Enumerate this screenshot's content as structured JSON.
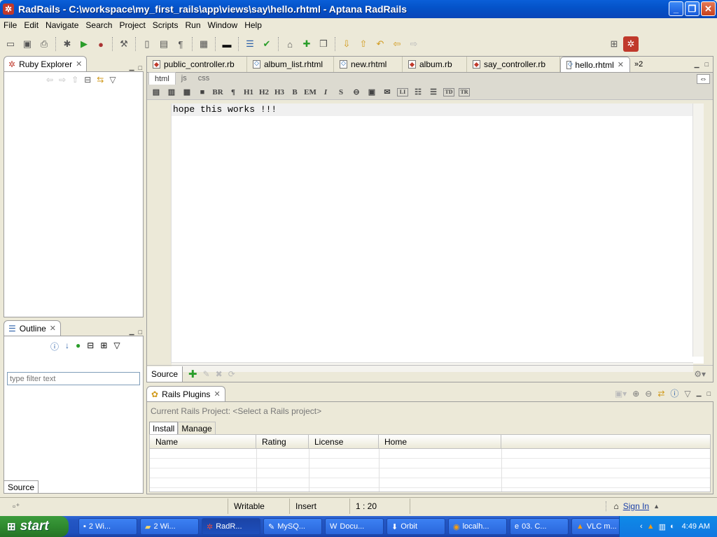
{
  "window": {
    "title": "RadRails - C:\\workspace\\my_first_rails\\app\\views\\say\\hello.rhtml - Aptana RadRails"
  },
  "menu": [
    "File",
    "Edit",
    "Navigate",
    "Search",
    "Project",
    "Scripts",
    "Run",
    "Window",
    "Help"
  ],
  "ruby_explorer": {
    "title": "Ruby Explorer"
  },
  "outline": {
    "title": "Outline",
    "filter_placeholder": "type filter text",
    "source_tab": "Source"
  },
  "editor": {
    "tabs": [
      {
        "label": "public_controller.rb",
        "type": "rb"
      },
      {
        "label": "album_list.rhtml",
        "type": "html"
      },
      {
        "label": "new.rhtml",
        "type": "html"
      },
      {
        "label": "album.rb",
        "type": "rb"
      },
      {
        "label": "say_controller.rb",
        "type": "rb"
      },
      {
        "label": "hello.rhtml",
        "type": "html",
        "active": true
      }
    ],
    "overflow_count": "»2",
    "subtabs": [
      "html",
      "js",
      "css"
    ],
    "format_buttons": [
      "BR",
      "¶",
      "H1",
      "H2",
      "H3",
      "B",
      "EM",
      "I",
      "S",
      "LI",
      "TD",
      "TR"
    ],
    "content": "hope this works !!!",
    "source_tab": "Source"
  },
  "plugins": {
    "title": "Rails Plugins",
    "project_label": "Current Rails Project: <Select a Rails project>",
    "tabs": [
      "Install",
      "Manage"
    ],
    "columns": [
      "Name",
      "Rating",
      "License",
      "Home"
    ]
  },
  "status": {
    "mode": "Writable",
    "insert": "Insert",
    "position": "1 : 20",
    "sign_in": "Sign In"
  },
  "taskbar": {
    "start": "start",
    "items": [
      "2 Wi...",
      "2 Wi...",
      "RadR...",
      "MySQ...",
      "Docu...",
      "Orbit",
      "localh...",
      "03. C...",
      "VLC m..."
    ],
    "clock": "4:49 AM"
  },
  "colors": {
    "titlebar": "#0453c9",
    "taskbar": "#245edb",
    "start": "#2f8a2f"
  }
}
